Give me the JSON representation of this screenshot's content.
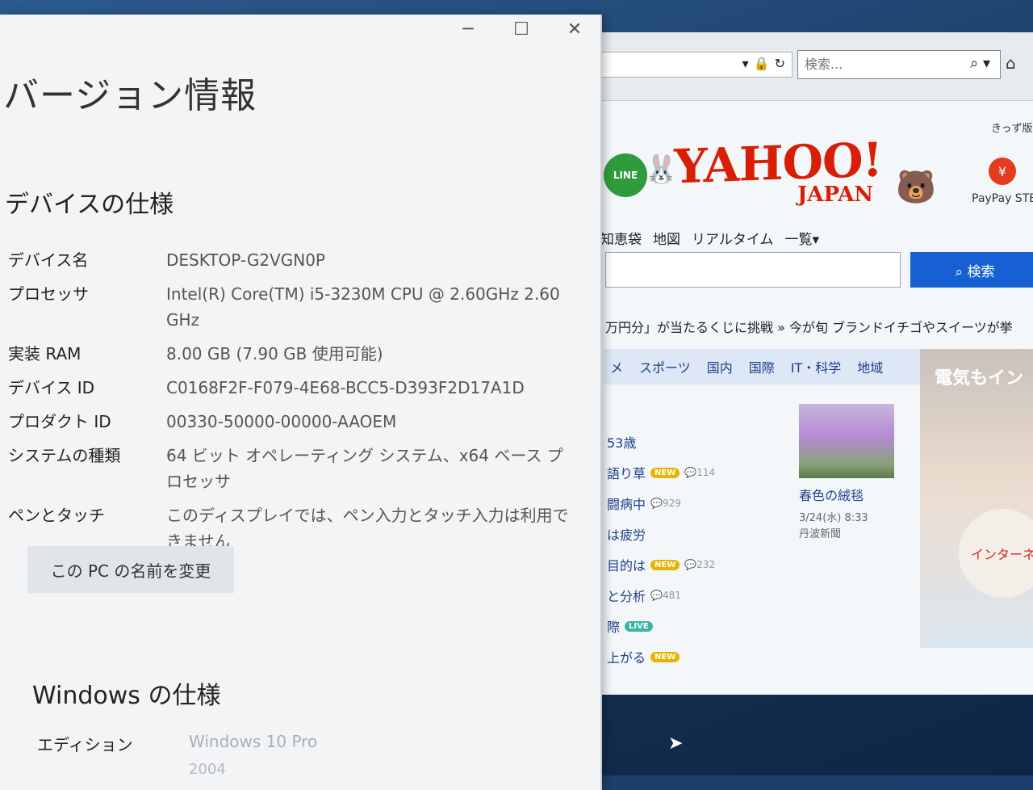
{
  "about_window": {
    "controls": {
      "minimize": "─",
      "maximize": "☐",
      "close": "✕"
    },
    "title": "バージョン情報",
    "device_spec": {
      "heading": "デバイスの仕様",
      "rows": [
        {
          "label": "デバイス名",
          "value": "DESKTOP-G2VGN0P"
        },
        {
          "label": "プロセッサ",
          "value": "Intel(R) Core(TM) i5-3230M CPU @ 2.60GHz   2.60 GHz"
        },
        {
          "label": "実装 RAM",
          "value": "8.00 GB (7.90 GB 使用可能)"
        },
        {
          "label": "デバイス ID",
          "value": "C0168F2F-F079-4E68-BCC5-D393F2D17A1D"
        },
        {
          "label": "プロダクト ID",
          "value": "00330-50000-00000-AAOEM"
        },
        {
          "label": "システムの種類",
          "value": "64 ビット オペレーティング システム、x64 ベース プロセッサ"
        },
        {
          "label": "ペンとタッチ",
          "value": "このディスプレイでは、ペン入力とタッチ入力は利用できません"
        }
      ],
      "rename_button": "この PC の名前を変更"
    },
    "windows_spec": {
      "heading": "Windows の仕様",
      "edition_label": "エディション",
      "edition_value": "Windows 10 Pro",
      "version_value": "2004"
    }
  },
  "browser": {
    "search_placeholder": "検索...",
    "kids_label": "きっず版",
    "line_label": "LINE",
    "logo_main": "YAHOO!",
    "logo_sub": "JAPAN",
    "paypay_label": "PayPay STE",
    "service_nav": [
      "知恵袋",
      "地図",
      "リアルタイム",
      "一覧▾"
    ],
    "search_button": "検索",
    "promo_text": "万円分」が当たるくじに挑戦   » 今が旬  ブランドイチゴやスイーツが挙",
    "news_tabs": [
      "メ",
      "スポーツ",
      "国内",
      "国際",
      "IT・科学",
      "地域"
    ],
    "news_items": [
      {
        "text": "53歳",
        "badge": "",
        "count": ""
      },
      {
        "text": "語り草",
        "badge": "NEW",
        "count": "114"
      },
      {
        "text": "闘病中",
        "badge": "",
        "count": "929"
      },
      {
        "text": "は疲労",
        "badge": "",
        "count": ""
      },
      {
        "text": "目的は",
        "badge": "NEW",
        "count": "232"
      },
      {
        "text": "と分析",
        "badge": "",
        "count": "481"
      },
      {
        "text": "際",
        "badge": "LIVE",
        "count": ""
      },
      {
        "text": "上がる",
        "badge": "NEW",
        "count": ""
      }
    ],
    "photo_title": "春色の絨毯",
    "photo_date": "3/24(水) 8:33",
    "photo_source": "丹波新聞",
    "ad_text": "電気もイン",
    "ad_circle_text": "インターネ"
  },
  "colors": {
    "yahoo_red": "#d81e05",
    "search_blue": "#1760d4",
    "new_badge": "#e8b400",
    "live_badge": "#3cb3a4"
  }
}
